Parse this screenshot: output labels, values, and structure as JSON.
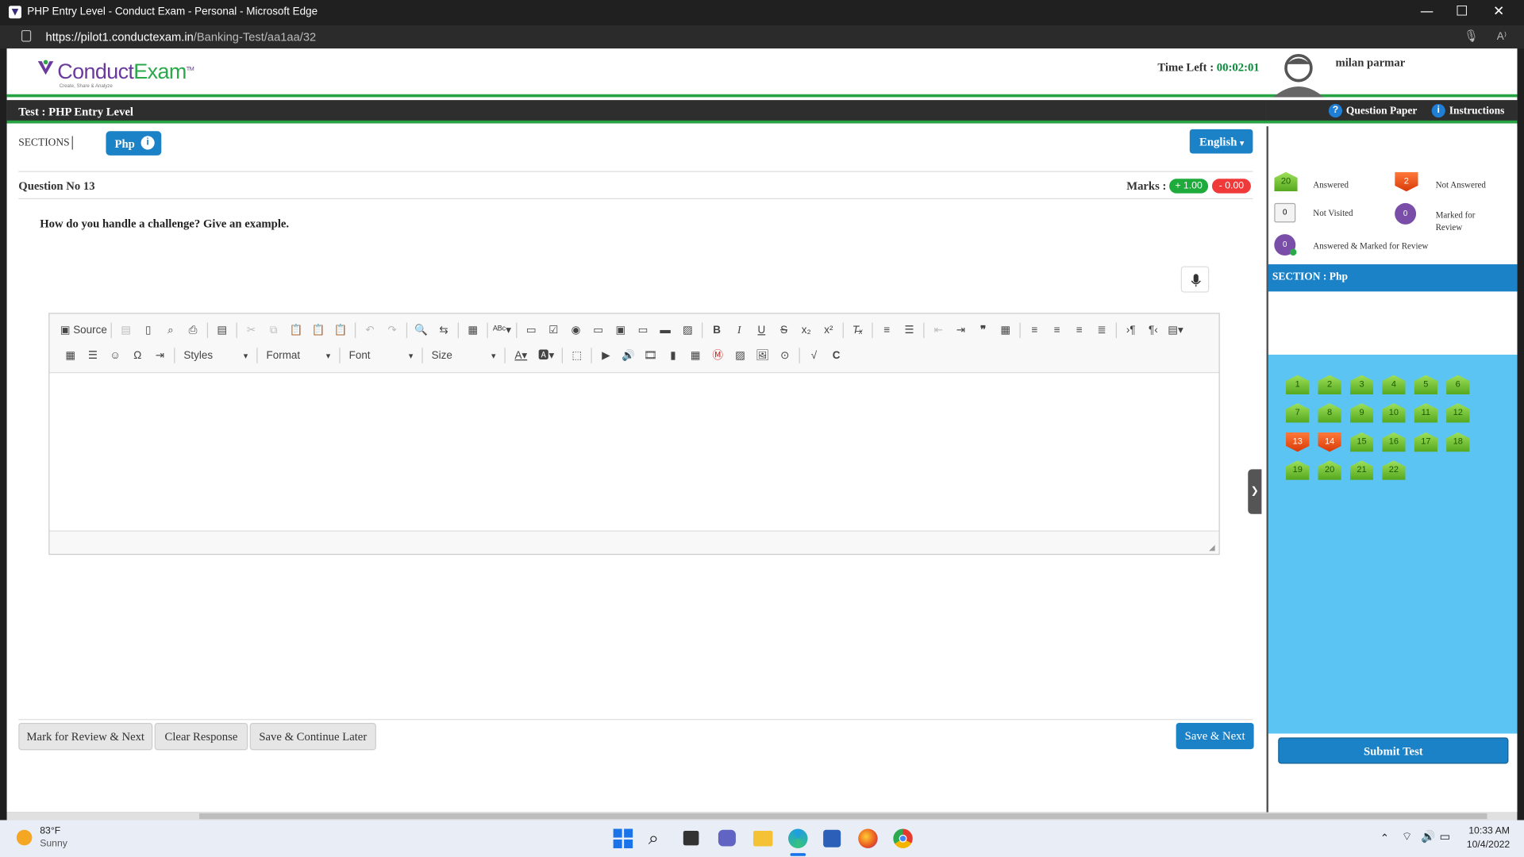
{
  "browser": {
    "title": "PHP Entry Level - Conduct Exam - Personal - Microsoft Edge",
    "url_host": "https://pilot1.conductexam.in",
    "url_path": "/Banking-Test/aa1aa/32",
    "minimize": "—",
    "maximize": "☐",
    "close": "✕"
  },
  "header": {
    "logo_part1": "Conduct",
    "logo_part2": "Exam",
    "logo_tm": "TM",
    "logo_tagline": "Create, Share & Analyze",
    "time_label": "Time Left :",
    "time_value": "00:02:01",
    "username": "milan parmar"
  },
  "testbar": {
    "test_title": "Test : PHP Entry Level",
    "question_paper": "Question Paper",
    "instructions": "Instructions"
  },
  "sections": {
    "label": "SECTIONS",
    "active_section": "Php",
    "language": "English"
  },
  "question": {
    "number": "Question No 13",
    "marks_label": "Marks :",
    "positive": "+ 1.00",
    "negative": "- 0.00",
    "text": "How do you handle a challenge? Give an example."
  },
  "editor": {
    "source_label": "Source",
    "styles": "Styles",
    "format": "Format",
    "font": "Font",
    "size": "Size"
  },
  "actions": {
    "mark_review": "Mark for Review & Next",
    "clear": "Clear Response",
    "save_later": "Save & Continue Later",
    "save_next": "Save & Next"
  },
  "legend": {
    "answered_count": "20",
    "answered": "Answered",
    "not_answered_count": "2",
    "not_answered": "Not Answered",
    "not_visited_count": "0",
    "not_visited": "Not Visited",
    "marked_count": "0",
    "marked_line1": "Marked for",
    "marked_line2": "Review",
    "ans_marked_count": "0",
    "ans_marked": "Answered & Marked for Review"
  },
  "palette": {
    "section_title": "SECTION : Php",
    "questions": [
      {
        "n": "1",
        "s": "ans"
      },
      {
        "n": "2",
        "s": "ans"
      },
      {
        "n": "3",
        "s": "ans"
      },
      {
        "n": "4",
        "s": "ans"
      },
      {
        "n": "5",
        "s": "ans"
      },
      {
        "n": "6",
        "s": "ans"
      },
      {
        "n": "7",
        "s": "ans"
      },
      {
        "n": "8",
        "s": "ans"
      },
      {
        "n": "9",
        "s": "ans"
      },
      {
        "n": "10",
        "s": "ans"
      },
      {
        "n": "11",
        "s": "ans"
      },
      {
        "n": "12",
        "s": "ans"
      },
      {
        "n": "13",
        "s": "na"
      },
      {
        "n": "14",
        "s": "na"
      },
      {
        "n": "15",
        "s": "ans"
      },
      {
        "n": "16",
        "s": "ans"
      },
      {
        "n": "17",
        "s": "ans"
      },
      {
        "n": "18",
        "s": "ans"
      },
      {
        "n": "19",
        "s": "ans"
      },
      {
        "n": "20",
        "s": "ans"
      },
      {
        "n": "21",
        "s": "ans"
      },
      {
        "n": "22",
        "s": "ans"
      }
    ],
    "submit": "Submit Test"
  },
  "taskbar": {
    "temp": "83°F",
    "weather": "Sunny",
    "time": "10:33 AM",
    "date": "10/4/2022"
  }
}
